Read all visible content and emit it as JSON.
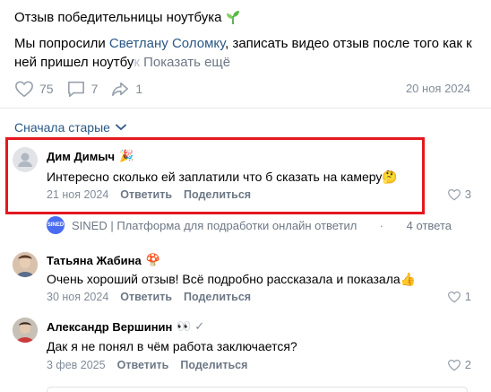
{
  "post": {
    "title": "Отзыв победительницы ноутбука",
    "text_prefix": "Мы попросили ",
    "mention": "Светлану Соломку",
    "text_middle": ", записать видео отзыв после того как к ней пришел ноутбу",
    "text_faded": "к",
    "more": "Показать ещё",
    "likes": "75",
    "comments": "7",
    "shares": "1",
    "date": "20 ноя 2024"
  },
  "sort": {
    "label": "Сначала старые"
  },
  "comments": [
    {
      "author": "Дим Димыч",
      "badge": "🎉",
      "text": "Интересно сколько ей заплатили что б сказать на камеру🤔",
      "date": "21 ноя 2024",
      "reply": "Ответить",
      "share": "Поделиться",
      "likes": "3"
    },
    {
      "author": "Татьяна Жабина",
      "badge": "🍄",
      "text": "Очень хороший отзыв! Всё подробно рассказала и показала👍",
      "date": "30 ноя 2024",
      "reply": "Ответить",
      "share": "Поделиться",
      "likes": "1"
    },
    {
      "author": "Александр Вершинин",
      "badge": "👀 ✓",
      "text": "Дак я не понял в чём работа заключается?",
      "date": "3 фев 2025",
      "reply": "Ответить",
      "share": "Поделиться",
      "likes": "2"
    }
  ],
  "reply_thread": {
    "logo_text": "SINED",
    "name": "SINED | Платформа для подработки онлайн ответил",
    "count": "4 ответа"
  },
  "colors": {
    "link": "#2a5885",
    "muted": "#818c99",
    "highlight": "#e5171e"
  }
}
